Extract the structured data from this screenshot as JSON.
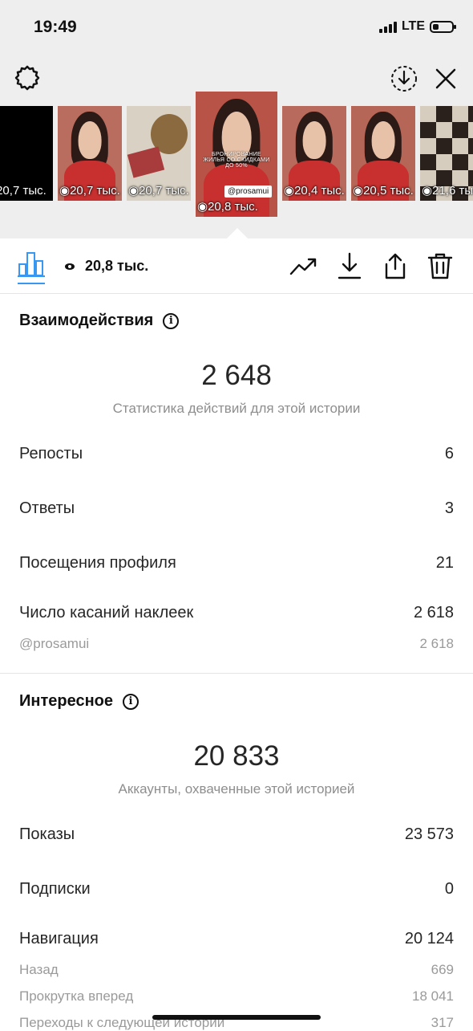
{
  "status_bar": {
    "time": "19:49",
    "network": "LTE"
  },
  "thumbnails": [
    {
      "views": "20,7 тыс."
    },
    {
      "views": "20,7 тыс."
    },
    {
      "views": "20,7 тыс."
    },
    {
      "views": "20,8 тыс.",
      "tag": "@prosamui",
      "caption": "БРОНИРОВАНИЕ ЖИЛЬЯ СО СКИДКАМИ ДО 50%"
    },
    {
      "views": "20,4 тыс."
    },
    {
      "views": "20,5 тыс."
    },
    {
      "views": "21,6 тыс."
    }
  ],
  "toolbar": {
    "views": "20,8 тыс."
  },
  "interactions": {
    "title": "Взаимодействия",
    "total": "2 648",
    "subtitle": "Статистика действий для этой истории",
    "rows": [
      {
        "label": "Репосты",
        "value": "6"
      },
      {
        "label": "Ответы",
        "value": "3"
      },
      {
        "label": "Посещения профиля",
        "value": "21"
      },
      {
        "label": "Число касаний наклеек",
        "value": "2 618"
      }
    ],
    "sticker": {
      "label": "@prosamui",
      "value": "2 618"
    }
  },
  "discovery": {
    "title": "Интересное",
    "total": "20 833",
    "subtitle": "Аккаунты, охваченные этой историей",
    "rows": [
      {
        "label": "Показы",
        "value": "23 573"
      },
      {
        "label": "Подписки",
        "value": "0"
      },
      {
        "label": "Навигация",
        "value": "20 124"
      }
    ],
    "nav_rows": [
      {
        "label": "Назад",
        "value": "669"
      },
      {
        "label": "Прокрутка вперед",
        "value": "18 041"
      },
      {
        "label": "Переходы к следующей истории",
        "value": "317"
      }
    ]
  }
}
